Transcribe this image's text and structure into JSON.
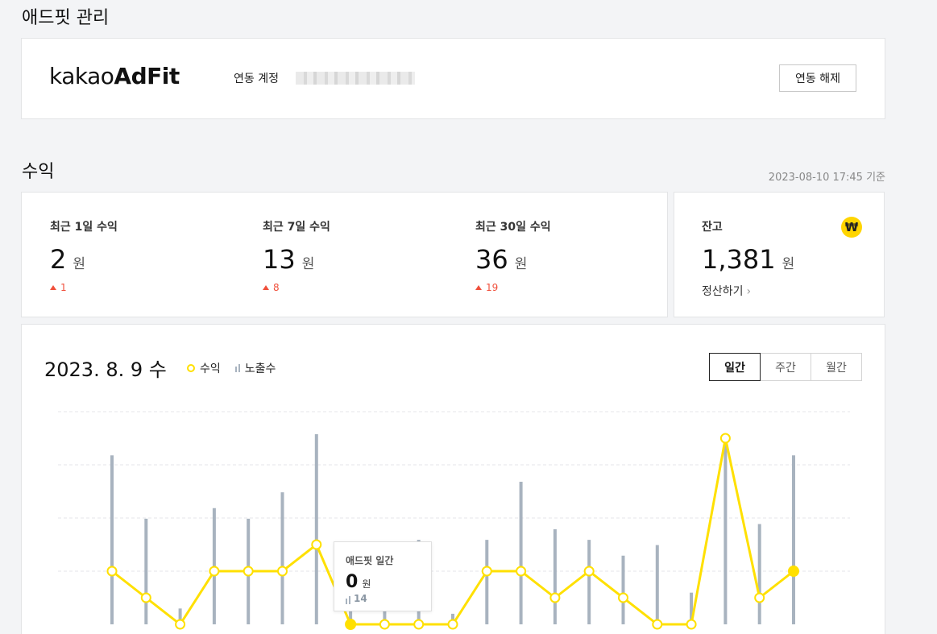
{
  "page": {
    "title": "애드핏 관리"
  },
  "adfit": {
    "logo_light": "kakao",
    "logo_bold": "AdFit",
    "linked_label": "연동 계정",
    "unlink_label": "연동 해제"
  },
  "revenue": {
    "section_title": "수익",
    "basis_time": "2023-08-10 17:45 기준",
    "stats": [
      {
        "label": "최근 1일 수익",
        "value": "2",
        "unit": "원",
        "delta": "1"
      },
      {
        "label": "최근 7일 수익",
        "value": "13",
        "unit": "원",
        "delta": "8"
      },
      {
        "label": "최근 30일 수익",
        "value": "36",
        "unit": "원",
        "delta": "19"
      }
    ],
    "balance": {
      "label": "잔고",
      "value": "1,381",
      "unit": "원",
      "link": "정산하기",
      "link_chevron": "›",
      "icon": "won-icon",
      "icon_glyph": "₩"
    }
  },
  "chart_panel": {
    "date": "2023. 8. 9 수",
    "legend": {
      "revenue": "수익",
      "impressions": "노출수"
    },
    "tabs": [
      "일간",
      "주간",
      "월간"
    ],
    "active_tab": 0,
    "tooltip": {
      "title": "애드핏 일간",
      "value": "0",
      "unit": "원",
      "impressions": "14"
    }
  },
  "chart_data": {
    "type": "line",
    "x": [
      1,
      2,
      3,
      4,
      5,
      6,
      7,
      8,
      9,
      10,
      11,
      12,
      13,
      14,
      15,
      16,
      17,
      18,
      19,
      20,
      21,
      22
    ],
    "series": [
      {
        "name": "수익",
        "values": [
          2,
          1,
          0,
          2,
          2,
          2,
          3,
          0,
          0,
          0,
          0,
          2,
          2,
          1,
          2,
          1,
          0,
          0,
          7,
          1,
          2,
          null
        ]
      },
      {
        "name": "노출수",
        "values": [
          32,
          20,
          3,
          22,
          20,
          25,
          36,
          5,
          10,
          16,
          2,
          16,
          27,
          18,
          16,
          13,
          15,
          6,
          34,
          19,
          32,
          null
        ]
      }
    ],
    "highlight_index": 7,
    "grid": true
  },
  "colors": {
    "accent": "#ffe000",
    "bar": "#a8b3bf",
    "up": "#f0503c"
  }
}
